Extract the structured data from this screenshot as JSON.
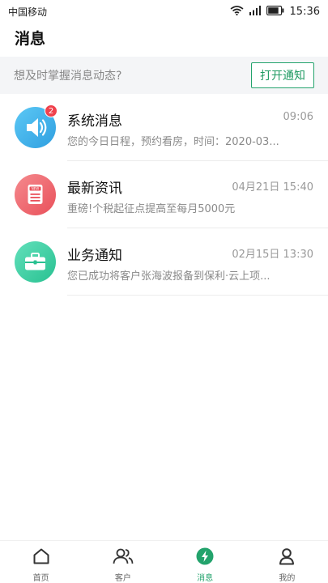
{
  "status_bar": {
    "carrier": "中国移动",
    "time": "15:36"
  },
  "header": {
    "title": "消息"
  },
  "notice": {
    "text": "想及时掌握消息动态?",
    "button_label": "打开通知"
  },
  "messages": [
    {
      "title": "系统消息",
      "time": "09:06",
      "preview": "您的今日日程，预约看房，时间：2020-03...",
      "badge": "2",
      "icon": "speaker-icon",
      "color": "#3fb3ea"
    },
    {
      "title": "最新资讯",
      "time": "04月21日 15:40",
      "preview": "重磅!个税起征点提高至每月5000元",
      "badge": "",
      "icon": "news-icon",
      "color": "#f0646a"
    },
    {
      "title": "业务通知",
      "time": "02月15日 13:30",
      "preview": "您已成功将客户张海波报备到保利·云上项...",
      "badge": "",
      "icon": "briefcase-icon",
      "color": "#3fd1a5"
    }
  ],
  "tabs": [
    {
      "label": "首页",
      "icon": "home-icon",
      "active": false
    },
    {
      "label": "客户",
      "icon": "customers-icon",
      "active": false
    },
    {
      "label": "消息",
      "icon": "lightning-icon",
      "active": true
    },
    {
      "label": "我的",
      "icon": "profile-icon",
      "active": false
    }
  ],
  "colors": {
    "accent": "#23a36c",
    "badge": "#f0414c"
  }
}
